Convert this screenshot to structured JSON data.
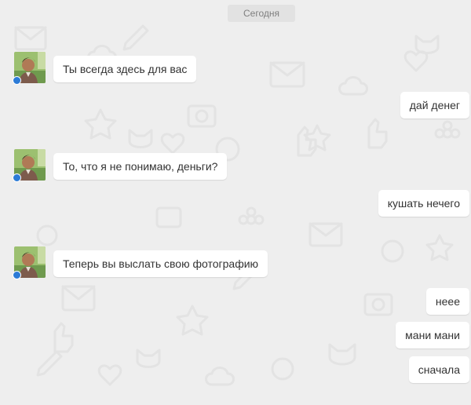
{
  "chat": {
    "date_separator": "Сегодня",
    "messages": [
      {
        "direction": "incoming",
        "text": "Ты всегда здесь для вас"
      },
      {
        "direction": "outgoing",
        "text": "дай денег"
      },
      {
        "direction": "incoming",
        "text": "То, что я не понимаю, деньги?"
      },
      {
        "direction": "outgoing",
        "text": "кушать нечего"
      },
      {
        "direction": "incoming",
        "text": "Теперь вы выслать свою фотографию"
      },
      {
        "direction": "outgoing",
        "text": "неее"
      },
      {
        "direction": "outgoing",
        "text": "мани мани"
      },
      {
        "direction": "outgoing",
        "text": "сначала"
      }
    ]
  },
  "colors": {
    "background": "#eeeeee",
    "bubble": "#ffffff",
    "online_indicator": "#2c7bd6",
    "date_pill": "#e2e2e2"
  },
  "icons": [
    "avatar-photo",
    "online-indicator-icon"
  ]
}
